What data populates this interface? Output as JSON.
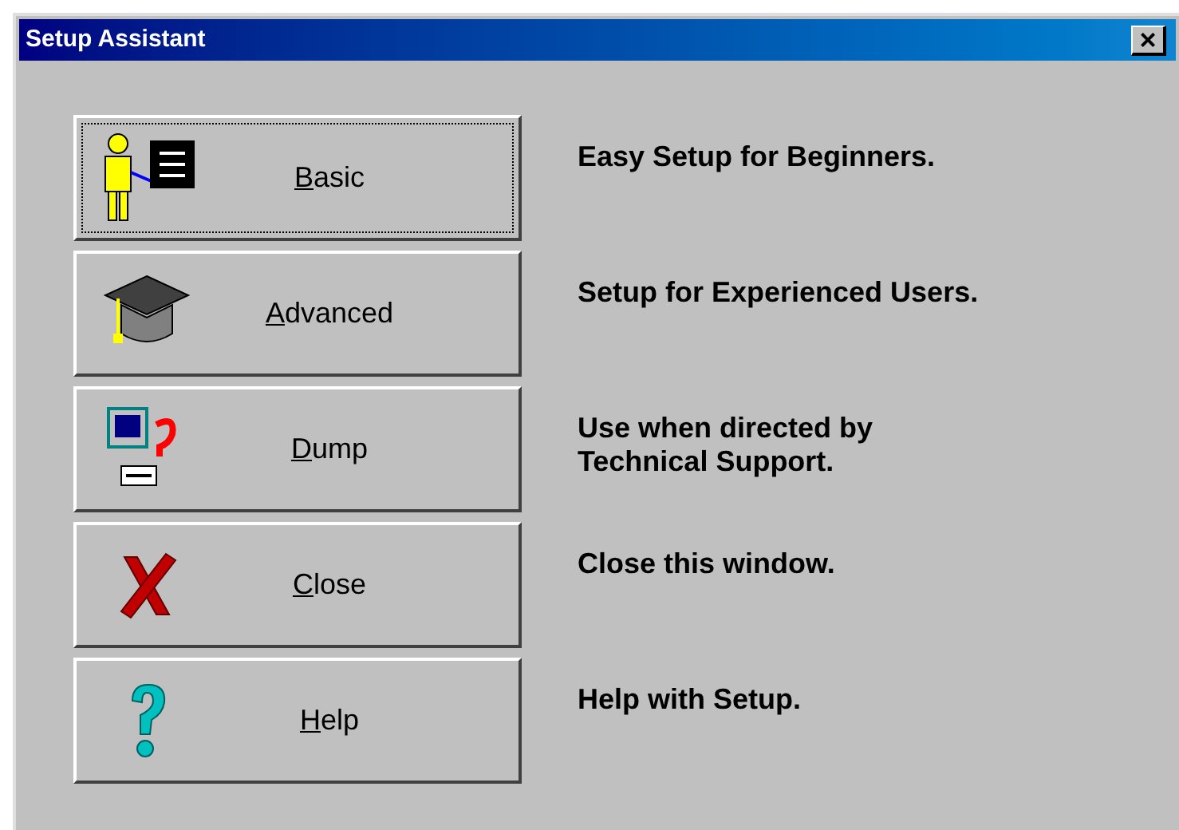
{
  "window": {
    "title": "Setup Assistant",
    "close_glyph": "×"
  },
  "options": [
    {
      "kind": "person",
      "label": "Basic",
      "focused": true,
      "description_lines": [
        "Easy Setup for Beginners."
      ]
    },
    {
      "kind": "cap",
      "label": "Advanced",
      "focused": false,
      "description_lines": [
        "Setup for Experienced Users."
      ]
    },
    {
      "kind": "dump",
      "label": "Dump",
      "focused": false,
      "description_lines": [
        "Use when directed by",
        "Technical Support."
      ]
    },
    {
      "kind": "close",
      "label": "Close",
      "focused": false,
      "description_lines": [
        "Close this window."
      ]
    },
    {
      "kind": "help",
      "label": "Help",
      "focused": false,
      "description_lines": [
        "Help with Setup."
      ]
    }
  ]
}
